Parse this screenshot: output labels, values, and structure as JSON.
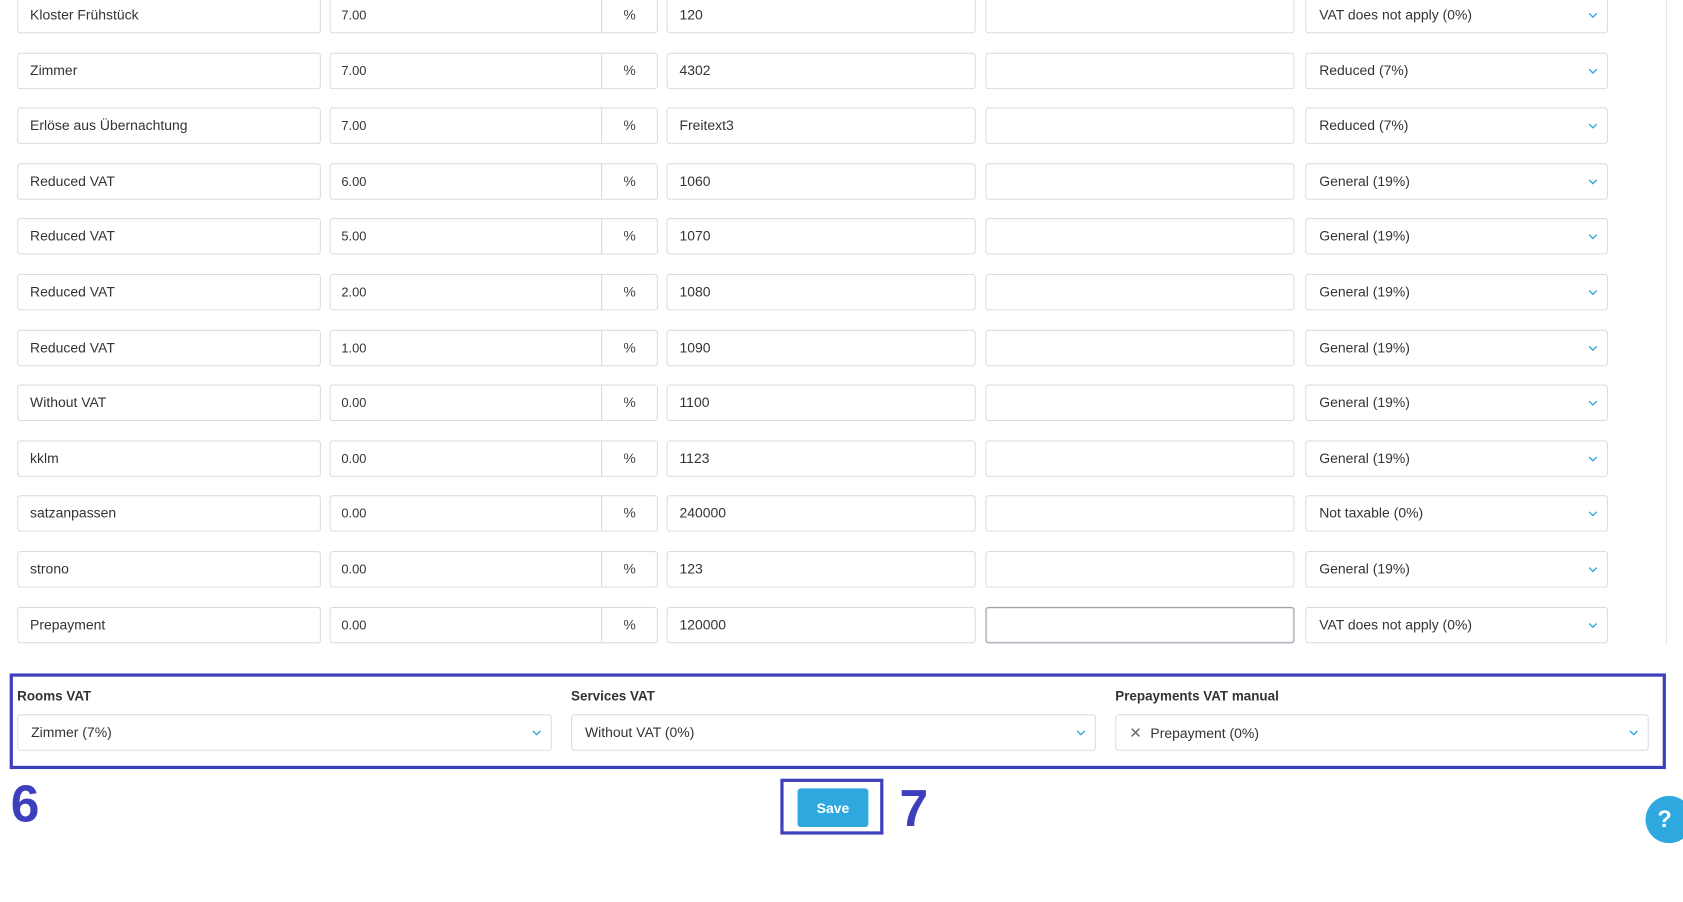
{
  "rows": [
    {
      "name": "Kloster Frühstück",
      "rate": "7.00",
      "pct": "%",
      "account": "120",
      "extra": "",
      "vat": "VAT does not apply (0%)"
    },
    {
      "name": "Zimmer",
      "rate": "7.00",
      "pct": "%",
      "account": "4302",
      "extra": "",
      "vat": "Reduced (7%)"
    },
    {
      "name": "Erlöse aus Übernachtung",
      "rate": "7.00",
      "pct": "%",
      "account": "Freitext3",
      "extra": "",
      "vat": "Reduced (7%)"
    },
    {
      "name": "Reduced VAT",
      "rate": "6.00",
      "pct": "%",
      "account": "1060",
      "extra": "",
      "vat": "General (19%)"
    },
    {
      "name": "Reduced VAT",
      "rate": "5.00",
      "pct": "%",
      "account": "1070",
      "extra": "",
      "vat": "General (19%)"
    },
    {
      "name": "Reduced VAT",
      "rate": "2.00",
      "pct": "%",
      "account": "1080",
      "extra": "",
      "vat": "General (19%)"
    },
    {
      "name": "Reduced VAT",
      "rate": "1.00",
      "pct": "%",
      "account": "1090",
      "extra": "",
      "vat": "General (19%)"
    },
    {
      "name": "Without VAT",
      "rate": "0.00",
      "pct": "%",
      "account": "1100",
      "extra": "",
      "vat": "General (19%)"
    },
    {
      "name": "kklm",
      "rate": "0.00",
      "pct": "%",
      "account": "1123",
      "extra": "",
      "vat": "General (19%)"
    },
    {
      "name": "satzanpassen",
      "rate": "0.00",
      "pct": "%",
      "account": "240000",
      "extra": "",
      "vat": "Not taxable (0%)"
    },
    {
      "name": "strono",
      "rate": "0.00",
      "pct": "%",
      "account": "123",
      "extra": "",
      "vat": "General (19%)"
    },
    {
      "name": "Prepayment",
      "rate": "0.00",
      "pct": "%",
      "account": "120000",
      "extra": "",
      "vat": "VAT does not apply (0%)"
    }
  ],
  "vat_settings": {
    "rooms_label": "Rooms VAT",
    "rooms_value": "Zimmer (7%)",
    "services_label": "Services VAT",
    "services_value": "Without VAT (0%)",
    "prepayments_label": "Prepayments VAT manual",
    "prepayments_value": "Prepayment (0%)",
    "clear_symbol": "✕"
  },
  "save_label": "Save",
  "annotations": {
    "step6": "6",
    "step7": "7"
  },
  "help_label": "?",
  "colors": {
    "accent": "#2fa8e0",
    "annotation": "#3d3fbd"
  },
  "icons": {
    "dropdown": "chevron-down-icon",
    "clear": "close-icon",
    "help": "help-icon"
  }
}
